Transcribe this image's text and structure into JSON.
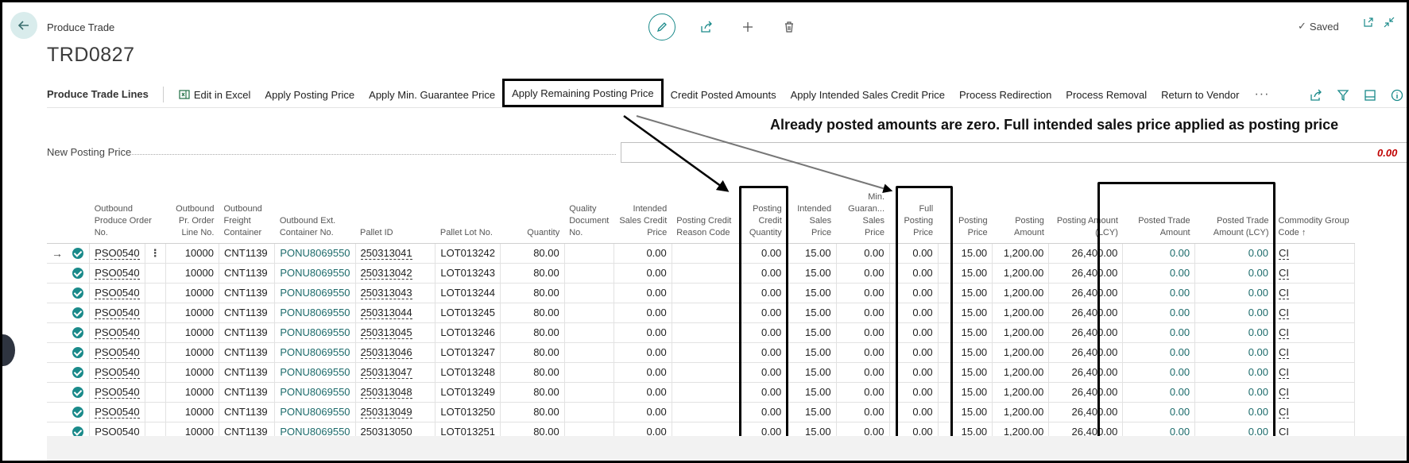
{
  "header": {
    "caption": "Produce Trade",
    "title": "TRD0827",
    "saved_label": "Saved"
  },
  "actionbar": {
    "title": "Produce Trade Lines",
    "items": [
      "Edit in Excel",
      "Apply Posting Price",
      "Apply Min. Guarantee Price",
      "Apply Remaining Posting Price",
      "Credit Posted Amounts",
      "Apply Intended Sales Credit Price",
      "Process Redirection",
      "Process Removal",
      "Return to Vendor"
    ],
    "more": "···"
  },
  "annotation": "Already posted amounts are zero. Full intended sales price applied as posting price",
  "new_posting_price": {
    "label": "New Posting Price",
    "value": "0.00"
  },
  "table": {
    "columns": [
      "Outbound Produce Order No.",
      "Outbound Pr. Order Line No.",
      "Outbound Freight Container",
      "Outbound Ext. Container No.",
      "Pallet ID",
      "Pallet Lot No.",
      "Quantity",
      "Quality Document No.",
      "Intended Sales Credit Price",
      "Posting Credit Reason Code",
      "Posting Credit Quantity",
      "Intended Sales Price",
      "Min. Guaran... Sales Price",
      "Full Posting Price",
      "Posting Price",
      "Posting Amount",
      "Posting Amount (LCY)",
      "Posted Trade Amount",
      "Posted Trade Amount (LCY)",
      "Commodity Group Code ↑"
    ],
    "rows": [
      [
        "PSO0540",
        "10000",
        "CNT1139",
        "PONU8069550",
        "250313041",
        "LOT013242",
        "80.00",
        "",
        "0.00",
        "",
        "0.00",
        "15.00",
        "0.00",
        "0.00",
        "15.00",
        "1,200.00",
        "26,400.00",
        "0.00",
        "0.00",
        "CI"
      ],
      [
        "PSO0540",
        "10000",
        "CNT1139",
        "PONU8069550",
        "250313042",
        "LOT013243",
        "80.00",
        "",
        "0.00",
        "",
        "0.00",
        "15.00",
        "0.00",
        "0.00",
        "15.00",
        "1,200.00",
        "26,400.00",
        "0.00",
        "0.00",
        "CI"
      ],
      [
        "PSO0540",
        "10000",
        "CNT1139",
        "PONU8069550",
        "250313043",
        "LOT013244",
        "80.00",
        "",
        "0.00",
        "",
        "0.00",
        "15.00",
        "0.00",
        "0.00",
        "15.00",
        "1,200.00",
        "26,400.00",
        "0.00",
        "0.00",
        "CI"
      ],
      [
        "PSO0540",
        "10000",
        "CNT1139",
        "PONU8069550",
        "250313044",
        "LOT013245",
        "80.00",
        "",
        "0.00",
        "",
        "0.00",
        "15.00",
        "0.00",
        "0.00",
        "15.00",
        "1,200.00",
        "26,400.00",
        "0.00",
        "0.00",
        "CI"
      ],
      [
        "PSO0540",
        "10000",
        "CNT1139",
        "PONU8069550",
        "250313045",
        "LOT013246",
        "80.00",
        "",
        "0.00",
        "",
        "0.00",
        "15.00",
        "0.00",
        "0.00",
        "15.00",
        "1,200.00",
        "26,400.00",
        "0.00",
        "0.00",
        "CI"
      ],
      [
        "PSO0540",
        "10000",
        "CNT1139",
        "PONU8069550",
        "250313046",
        "LOT013247",
        "80.00",
        "",
        "0.00",
        "",
        "0.00",
        "15.00",
        "0.00",
        "0.00",
        "15.00",
        "1,200.00",
        "26,400.00",
        "0.00",
        "0.00",
        "CI"
      ],
      [
        "PSO0540",
        "10000",
        "CNT1139",
        "PONU8069550",
        "250313047",
        "LOT013248",
        "80.00",
        "",
        "0.00",
        "",
        "0.00",
        "15.00",
        "0.00",
        "0.00",
        "15.00",
        "1,200.00",
        "26,400.00",
        "0.00",
        "0.00",
        "CI"
      ],
      [
        "PSO0540",
        "10000",
        "CNT1139",
        "PONU8069550",
        "250313048",
        "LOT013249",
        "80.00",
        "",
        "0.00",
        "",
        "0.00",
        "15.00",
        "0.00",
        "0.00",
        "15.00",
        "1,200.00",
        "26,400.00",
        "0.00",
        "0.00",
        "CI"
      ],
      [
        "PSO0540",
        "10000",
        "CNT1139",
        "PONU8069550",
        "250313049",
        "LOT013250",
        "80.00",
        "",
        "0.00",
        "",
        "0.00",
        "15.00",
        "0.00",
        "0.00",
        "15.00",
        "1,200.00",
        "26,400.00",
        "0.00",
        "0.00",
        "CI"
      ],
      [
        "PSO0540",
        "10000",
        "CNT1139",
        "PONU8069550",
        "250313050",
        "LOT013251",
        "80.00",
        "",
        "0.00",
        "",
        "0.00",
        "15.00",
        "0.00",
        "0.00",
        "15.00",
        "1,200.00",
        "26,400.00",
        "0.00",
        "0.00",
        "CI"
      ]
    ]
  },
  "colors": {
    "accent": "#1a8a8a",
    "link": "#1c6b6b",
    "negative": "#c00000"
  }
}
